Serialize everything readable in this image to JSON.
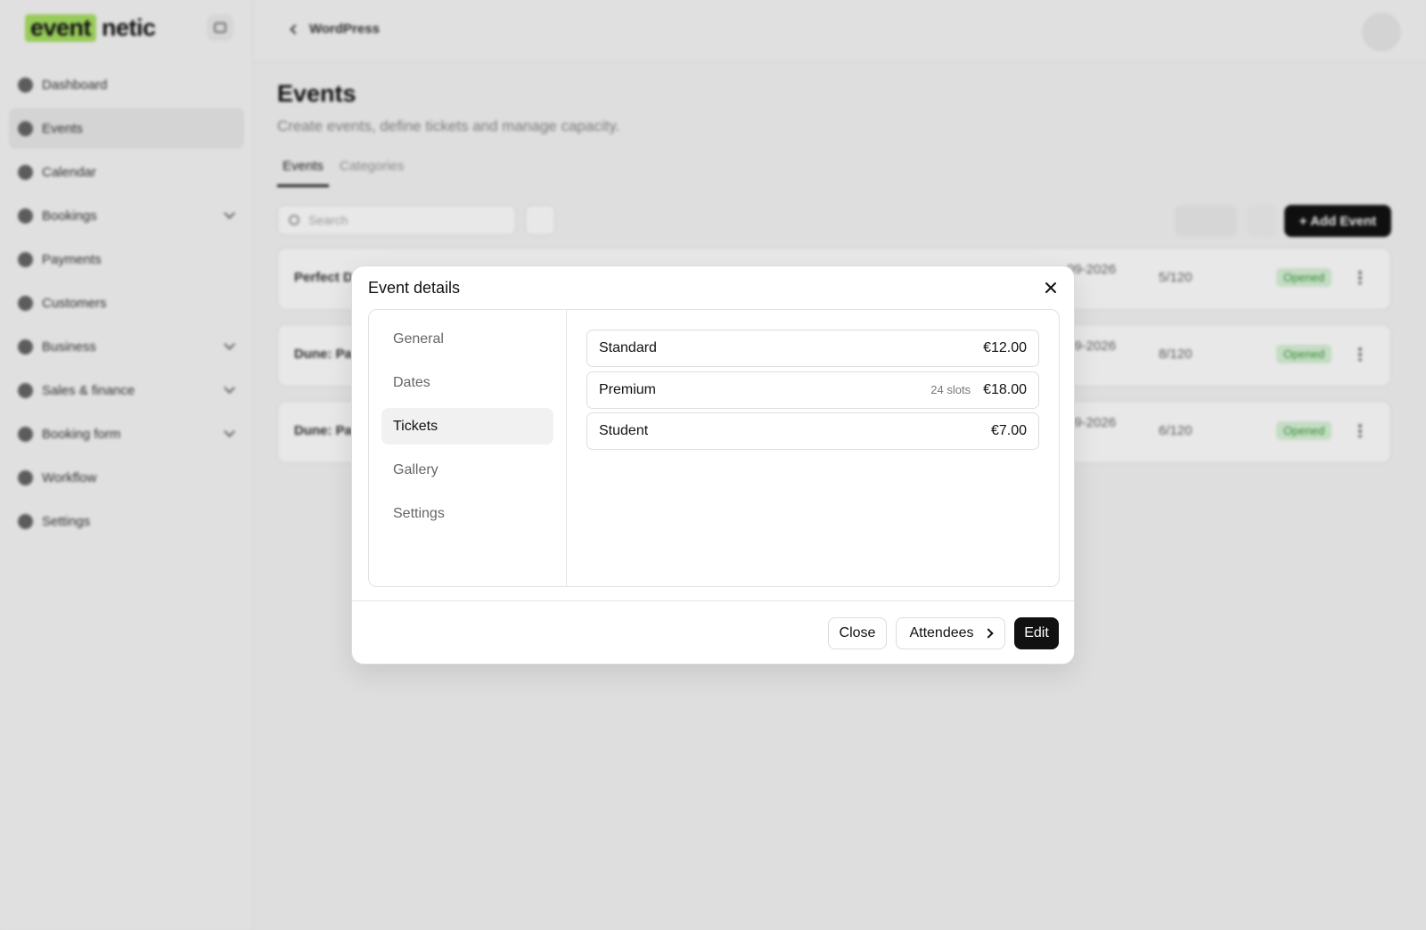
{
  "app": {
    "logo": {
      "highlight": "event",
      "rest": "netic",
      "accent": "#a8e063"
    },
    "sidebar": {
      "items": [
        {
          "label": "Dashboard",
          "icon": "dashboard-icon",
          "active": false,
          "expandable": false
        },
        {
          "label": "Events",
          "icon": "calendar-event-icon",
          "active": true,
          "expandable": false
        },
        {
          "label": "Calendar",
          "icon": "calendar-icon",
          "active": false,
          "expandable": false
        },
        {
          "label": "Bookings",
          "icon": "bookings-icon",
          "active": false,
          "expandable": true
        },
        {
          "label": "Payments",
          "icon": "payments-icon",
          "active": false,
          "expandable": false
        },
        {
          "label": "Customers",
          "icon": "customers-icon",
          "active": false,
          "expandable": false
        },
        {
          "label": "Business",
          "icon": "business-icon",
          "active": false,
          "expandable": true
        },
        {
          "label": "Sales & finance",
          "icon": "sales-icon",
          "active": false,
          "expandable": true
        },
        {
          "label": "Booking form",
          "icon": "form-icon",
          "active": false,
          "expandable": true
        },
        {
          "label": "Workflow",
          "icon": "workflow-icon",
          "active": false,
          "expandable": false
        },
        {
          "label": "Settings",
          "icon": "settings-icon",
          "active": false,
          "expandable": false
        }
      ]
    },
    "topbar": {
      "back_label": "WordPress"
    },
    "page": {
      "title": "Events",
      "subtitle": "Create events, define tickets and manage capacity.",
      "tabs": [
        {
          "label": "Events",
          "active": true
        },
        {
          "label": "Categories",
          "active": false
        }
      ],
      "search_placeholder": "Search",
      "add_button": "+ Add Event",
      "rows": [
        {
          "name": "Perfect D",
          "date": "-09-2026",
          "capacity": "5/120",
          "status": "Opened"
        },
        {
          "name": "Dune: Pa",
          "date": "-09-2026",
          "capacity": "8/120",
          "status": "Opened"
        },
        {
          "name": "Dune: Pa",
          "date": "-09-2026",
          "capacity": "6/120",
          "status": "Opened"
        }
      ]
    }
  },
  "modal": {
    "title": "Event details",
    "tabs": [
      {
        "label": "General",
        "active": false
      },
      {
        "label": "Dates",
        "active": false
      },
      {
        "label": "Tickets",
        "active": true
      },
      {
        "label": "Gallery",
        "active": false
      },
      {
        "label": "Settings",
        "active": false
      }
    ],
    "tickets": [
      {
        "name": "Standard",
        "slots": "",
        "price": "€12.00"
      },
      {
        "name": "Premium",
        "slots": "24 slots",
        "price": "€18.00"
      },
      {
        "name": "Student",
        "slots": "",
        "price": "€7.00"
      }
    ],
    "footer": {
      "close": "Close",
      "attendees": "Attendees",
      "edit": "Edit"
    }
  }
}
